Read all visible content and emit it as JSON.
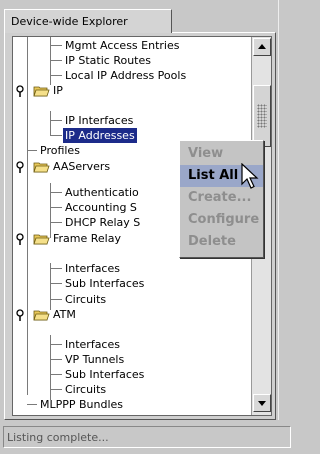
{
  "tab": {
    "label": "Device-wide Explorer"
  },
  "tree": {
    "items": [
      {
        "label": "Mgmt Access Entries"
      },
      {
        "label": "IP Static Routes"
      },
      {
        "label": "Local IP Address Pools"
      },
      {
        "label": "IP"
      },
      {
        "label": "IP Interfaces"
      },
      {
        "label": "IP Addresses"
      },
      {
        "label": "Profiles"
      },
      {
        "label": "AAServers"
      },
      {
        "label": "Authenticatio"
      },
      {
        "label": "Accounting S"
      },
      {
        "label": "DHCP Relay S"
      },
      {
        "label": "Frame Relay"
      },
      {
        "label": "Interfaces"
      },
      {
        "label": "Sub Interfaces"
      },
      {
        "label": "Circuits"
      },
      {
        "label": "ATM"
      },
      {
        "label": "Interfaces"
      },
      {
        "label": "VP Tunnels"
      },
      {
        "label": "Sub Interfaces"
      },
      {
        "label": "Circuits"
      },
      {
        "label": "MLPPP Bundles"
      }
    ]
  },
  "context_menu": {
    "items": [
      {
        "label": "View"
      },
      {
        "label": "List All"
      },
      {
        "label": "Create..."
      },
      {
        "label": "Configure"
      },
      {
        "label": "Delete"
      }
    ]
  },
  "status": {
    "text": "Listing complete..."
  },
  "colors": {
    "selection": "#1c2b8a",
    "menu_highlight": "#9aa7c9",
    "folder": "#e8c85a"
  }
}
